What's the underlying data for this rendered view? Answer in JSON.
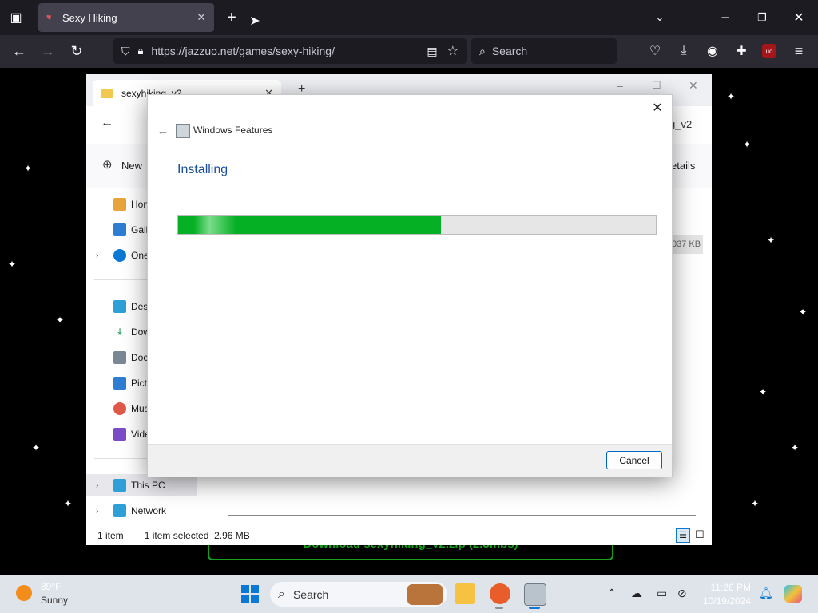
{
  "browser": {
    "tab_title": "Sexy Hiking",
    "url": "https://jazzuo.net/games/sexy-hiking/",
    "search_placeholder": "Search",
    "extension_badge": "uo"
  },
  "webpage": {
    "download_banner": "Download sexyhiking_v2.zip (2.3mbs)"
  },
  "explorer": {
    "tab_title": "sexyhiking_v2",
    "address_partial": "g_v2",
    "new_label": "New",
    "details_label": "etails",
    "file_size_partial": "037 KB",
    "sidebar": [
      {
        "label": "Hon",
        "icon": "home-icon",
        "color": "#e8a33d"
      },
      {
        "label": "Gall",
        "icon": "gallery-icon",
        "color": "#2d7dd2"
      },
      {
        "label": "One",
        "icon": "onedrive-icon",
        "color": "#0a78d4"
      },
      {
        "label": "Desl",
        "icon": "desktop-icon",
        "color": "#2f9fd8"
      },
      {
        "label": "Dow",
        "icon": "download-icon",
        "color": "#2a9d5c"
      },
      {
        "label": "Doc",
        "icon": "documents-icon",
        "color": "#7a8896"
      },
      {
        "label": "Pict",
        "icon": "pictures-icon",
        "color": "#2d7dd2"
      },
      {
        "label": "Mus",
        "icon": "music-icon",
        "color": "#e0584a"
      },
      {
        "label": "Vide",
        "icon": "videos-icon",
        "color": "#7b4cc8"
      },
      {
        "label": "This PC",
        "icon": "this-pc-icon",
        "color": "#2f9fd8"
      },
      {
        "label": "Network",
        "icon": "network-icon",
        "color": "#2f9fd8"
      }
    ],
    "status_items": "1 item",
    "status_selected": "1 item selected  2.96 MB"
  },
  "dialog": {
    "title": "Windows Features",
    "heading": "Installing",
    "progress": 0.55,
    "cancel_label": "Cancel"
  },
  "taskbar": {
    "weather_temp": "89°F",
    "weather_cond": "Sunny",
    "search_placeholder": "Search",
    "time": "11:26 PM",
    "date": "10/19/2024"
  }
}
